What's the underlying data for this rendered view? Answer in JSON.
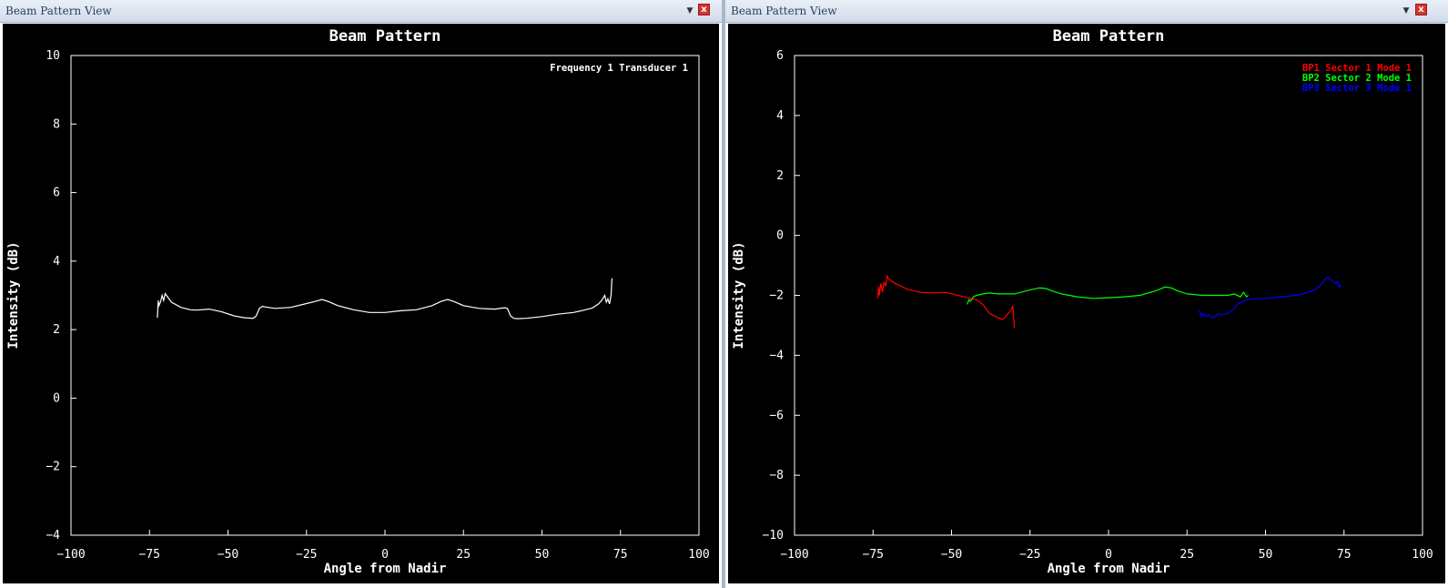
{
  "windows": [
    {
      "title": "Beam Pattern View",
      "dropdown_icon": "chevron-down-icon",
      "close_icon": "close-icon",
      "close_glyph": "x"
    },
    {
      "title": "Beam Pattern View",
      "dropdown_icon": "chevron-down-icon",
      "close_icon": "close-icon",
      "close_glyph": "x"
    }
  ],
  "colors": {
    "plot_bg": "#000000",
    "axis": "#ffffff",
    "text": "#ffffff"
  },
  "chart_data": [
    {
      "type": "line",
      "title": "Beam Pattern",
      "xlabel": "Angle from Nadir",
      "ylabel": "Intensity (dB)",
      "xlim": [
        -100,
        100
      ],
      "ylim": [
        -4,
        10
      ],
      "xticks": [
        -100,
        -75,
        -50,
        -25,
        0,
        25,
        50,
        75,
        100
      ],
      "yticks": [
        -4,
        -2,
        0,
        2,
        4,
        6,
        8,
        10
      ],
      "tick_labels_x": [
        "−100",
        "−75",
        "−50",
        "−25",
        "0",
        "25",
        "50",
        "75",
        "100"
      ],
      "tick_labels_y": [
        "−4",
        "−2",
        "0",
        "2",
        "4",
        "6",
        "8",
        "10"
      ],
      "grid": false,
      "legend_position": "top-right",
      "series": [
        {
          "name": "Frequency 1 Transducer 1",
          "color": "#ffffff",
          "x": [
            -72.5,
            -72.2,
            -72.0,
            -71.5,
            -71.0,
            -70.5,
            -70.0,
            -68,
            -65,
            -62,
            -60,
            -56,
            -52,
            -48,
            -45,
            -42,
            -41,
            -40,
            -39,
            -38,
            -35,
            -30,
            -25,
            -22,
            -20,
            -18,
            -15,
            -10,
            -5,
            0,
            5,
            10,
            15,
            18,
            20,
            22,
            25,
            30,
            35,
            38,
            39,
            40,
            41,
            42,
            45,
            50,
            55,
            60,
            63,
            66,
            68,
            69,
            70,
            70.5,
            71,
            71.5,
            72.0,
            72.3
          ],
          "y": [
            2.35,
            2.85,
            2.7,
            2.8,
            3.0,
            2.85,
            3.05,
            2.8,
            2.65,
            2.58,
            2.57,
            2.6,
            2.52,
            2.4,
            2.35,
            2.33,
            2.4,
            2.62,
            2.68,
            2.66,
            2.62,
            2.65,
            2.76,
            2.83,
            2.88,
            2.82,
            2.7,
            2.58,
            2.5,
            2.5,
            2.55,
            2.58,
            2.7,
            2.83,
            2.88,
            2.82,
            2.7,
            2.62,
            2.6,
            2.64,
            2.62,
            2.4,
            2.33,
            2.32,
            2.33,
            2.38,
            2.45,
            2.5,
            2.56,
            2.63,
            2.75,
            2.85,
            3.0,
            2.8,
            2.9,
            2.75,
            3.0,
            3.5
          ]
        }
      ]
    },
    {
      "type": "line",
      "title": "Beam Pattern",
      "xlabel": "Angle from Nadir",
      "ylabel": "Intensity (dB)",
      "xlim": [
        -100,
        100
      ],
      "ylim": [
        -10,
        6
      ],
      "xticks": [
        -100,
        -75,
        -50,
        -25,
        0,
        25,
        50,
        75,
        100
      ],
      "yticks": [
        -10,
        -8,
        -6,
        -4,
        -2,
        0,
        2,
        4,
        6
      ],
      "tick_labels_x": [
        "−100",
        "−75",
        "−50",
        "−25",
        "0",
        "25",
        "50",
        "75",
        "100"
      ],
      "tick_labels_y": [
        "−10",
        "−8",
        "−6",
        "−4",
        "−2",
        "0",
        "2",
        "4",
        "6"
      ],
      "grid": false,
      "legend_position": "top-right",
      "series": [
        {
          "name": "BP1 Sector 1 Mode 1",
          "color": "#ff0000",
          "x": [
            -73.5,
            -73.2,
            -73.0,
            -72.5,
            -72.0,
            -71.5,
            -71.0,
            -70.5,
            -70.0,
            -68,
            -66,
            -64,
            -62,
            -60,
            -56,
            -52,
            -48,
            -46,
            -44,
            -42,
            -40,
            -38,
            -36,
            -34,
            -33,
            -32,
            -31,
            -30.5,
            -30.2,
            -30.0
          ],
          "y": [
            -2.1,
            -1.7,
            -2.0,
            -1.6,
            -1.9,
            -1.55,
            -1.7,
            -1.35,
            -1.45,
            -1.6,
            -1.7,
            -1.8,
            -1.85,
            -1.9,
            -1.92,
            -1.9,
            -2.0,
            -2.05,
            -2.1,
            -2.15,
            -2.3,
            -2.6,
            -2.7,
            -2.8,
            -2.75,
            -2.6,
            -2.5,
            -2.35,
            -2.7,
            -3.1
          ]
        },
        {
          "name": "BP2 Sector 2 Mode 1",
          "color": "#00ff00",
          "x": [
            -45,
            -44.5,
            -44,
            -43,
            -42,
            -40,
            -38,
            -35,
            -30,
            -25,
            -22,
            -20,
            -18,
            -15,
            -10,
            -5,
            0,
            5,
            10,
            15,
            18,
            20,
            22,
            25,
            30,
            35,
            38,
            40,
            42,
            43,
            44,
            44.5
          ],
          "y": [
            -2.3,
            -2.15,
            -2.2,
            -2.05,
            -2.0,
            -1.95,
            -1.92,
            -1.95,
            -1.95,
            -1.82,
            -1.75,
            -1.77,
            -1.85,
            -1.95,
            -2.05,
            -2.1,
            -2.08,
            -2.05,
            -2.0,
            -1.85,
            -1.72,
            -1.75,
            -1.85,
            -1.95,
            -2.0,
            -2.0,
            -2.0,
            -1.95,
            -2.05,
            -1.9,
            -2.05,
            -2.0
          ]
        },
        {
          "name": "BP3 Sector 3 Mode 1",
          "color": "#0000ff",
          "x": [
            29,
            29.5,
            30,
            31,
            32,
            33,
            34,
            35,
            36,
            38,
            40,
            41,
            42,
            43,
            44,
            45,
            47,
            50,
            55,
            60,
            63,
            66,
            68,
            69,
            70,
            71,
            72,
            73,
            73.5,
            74
          ],
          "y": [
            -2.5,
            -2.7,
            -2.6,
            -2.7,
            -2.65,
            -2.75,
            -2.7,
            -2.6,
            -2.65,
            -2.6,
            -2.45,
            -2.3,
            -2.25,
            -2.2,
            -2.15,
            -2.12,
            -2.1,
            -2.1,
            -2.05,
            -2.0,
            -1.92,
            -1.8,
            -1.6,
            -1.45,
            -1.4,
            -1.5,
            -1.6,
            -1.55,
            -1.75,
            -1.65
          ]
        }
      ]
    }
  ]
}
